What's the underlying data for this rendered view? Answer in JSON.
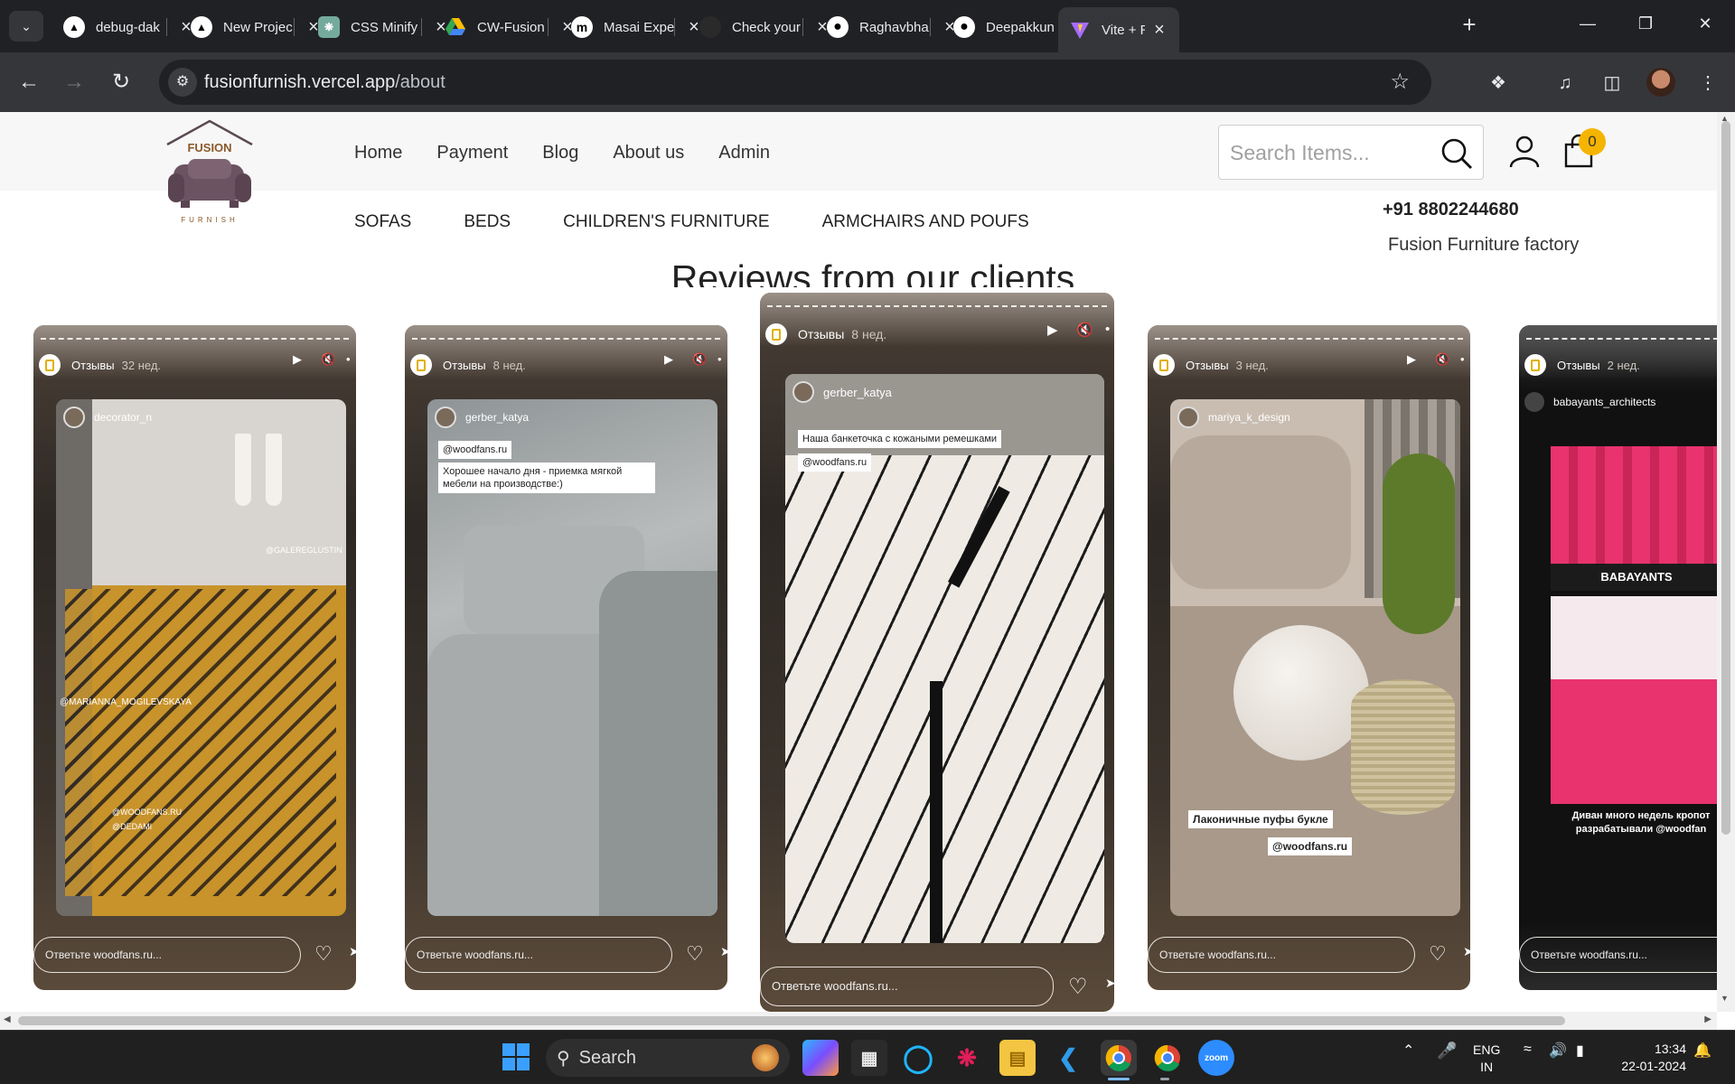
{
  "browser": {
    "tabs": [
      {
        "title": "debug-dak",
        "favicon": "vercel-icon"
      },
      {
        "title": "New Projec",
        "favicon": "vercel-icon"
      },
      {
        "title": "CSS Minify",
        "favicon": "chatgpt-icon"
      },
      {
        "title": "CW-Fusion",
        "favicon": "google-drive-icon"
      },
      {
        "title": "Masai Expe",
        "favicon": "masai-icon"
      },
      {
        "title": "Check your",
        "favicon": "dark-icon"
      },
      {
        "title": "Raghavbha",
        "favicon": "github-icon"
      },
      {
        "title": "Deepakkun",
        "favicon": "github-icon"
      },
      {
        "title": "Vite + Rea",
        "favicon": "vite-icon"
      }
    ],
    "url_host": "fusionfurnish.vercel.app",
    "url_path": "/about"
  },
  "site": {
    "logo_text_top": "FUSION",
    "logo_text_bottom": "FURNISH",
    "nav": [
      "Home",
      "Payment",
      "Blog",
      "About us",
      "Admin"
    ],
    "search_placeholder": "Search Items...",
    "cart_count": "0",
    "categories": [
      "SOFAS",
      "BEDS",
      "CHILDREN'S FURNITURE",
      "ARMCHAIRS AND POUFS"
    ],
    "phone": "+91 8802244680",
    "factory": "Fusion Furniture factory",
    "reviews_title": "Reviews from our clients"
  },
  "reviews": [
    {
      "account": "Отзывы",
      "age": "32 нед.",
      "user": "decorator_n",
      "captions": [
        "@GALEREGLUSTIN",
        "@MARIANNA_MOGILEVSKAYA",
        "@WOODFANS.RU",
        "@DEDAMI"
      ],
      "reply": "Ответьте woodfans.ru...",
      "photo_colors": [
        "#d7d3cf",
        "#c7932a",
        "#2a2018"
      ]
    },
    {
      "account": "Отзывы",
      "age": "8 нед.",
      "user": "gerber_katya",
      "captions": [
        "@woodfans.ru",
        "Хорошее начало дня - приемка мягкой мебели на производстве:)"
      ],
      "reply": "Ответьте woodfans.ru...",
      "photo_colors": [
        "#9ea3a5",
        "#c5c7c6",
        "#6f7476"
      ]
    },
    {
      "account": "Отзывы",
      "age": "8 нед.",
      "user": "gerber_katya",
      "captions": [
        "Наша банкеточка с кожаными ремешками",
        "@woodfans.ru"
      ],
      "reply": "Ответьте woodfans.ru...",
      "photo_colors": [
        "#efeae4",
        "#1c1c1c",
        "#bcb8b3"
      ]
    },
    {
      "account": "Отзывы",
      "age": "3 нед.",
      "user": "mariya_k_design",
      "captions": [
        "Лаконичные пуфы букле",
        "@woodfans.ru"
      ],
      "reply": "Ответьте woodfans.ru...",
      "photo_colors": [
        "#bfb3a6",
        "#e8e3dc",
        "#8f7d63"
      ]
    },
    {
      "account": "Отзывы",
      "age": "2 нед.",
      "user": "babayants_architects",
      "captions": [
        "BABAYANTS",
        "Диван много недель кропот",
        "разрабатывали @woodfan"
      ],
      "reply": "Ответьте woodfans.ru...",
      "photo_colors": [
        "#e8336e",
        "#1b1b1b",
        "#f05a8a"
      ]
    }
  ],
  "taskbar": {
    "search_label": "Search",
    "lang_top": "ENG",
    "lang_bottom": "IN",
    "time": "13:34",
    "date": "22-01-2024"
  }
}
